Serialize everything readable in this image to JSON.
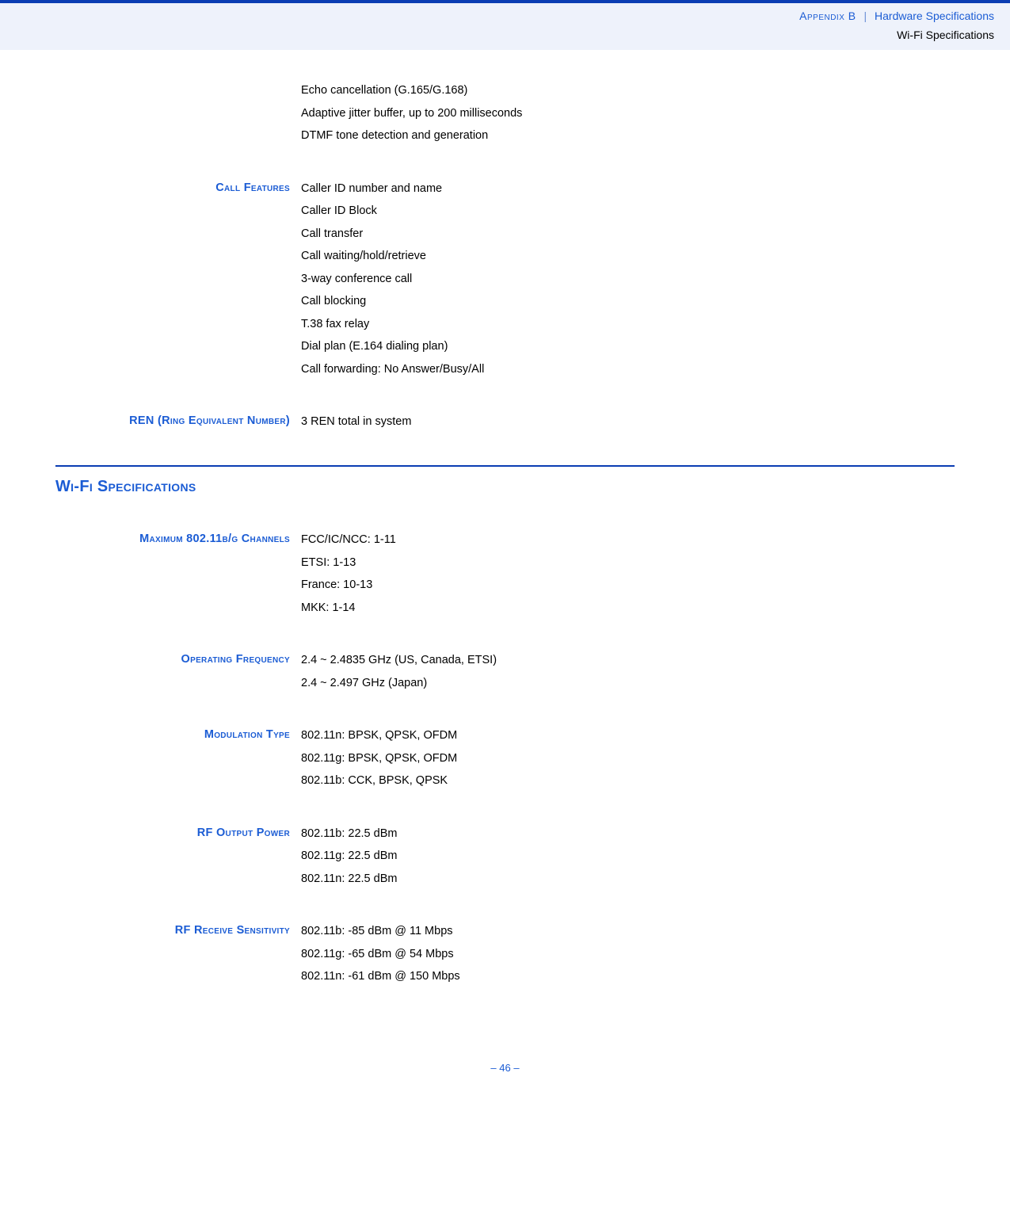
{
  "header": {
    "appendix_label": "Appendix B",
    "separator": "|",
    "chapter": "Hardware Specifications",
    "subtitle": "Wi-Fi Specifications"
  },
  "intro": {
    "lines": [
      "Echo cancellation (G.165/G.168)",
      "Adaptive jitter buffer, up to 200 milliseconds",
      "DTMF tone detection and generation"
    ]
  },
  "sections": [
    {
      "label": "Call Features",
      "lines": [
        "Caller ID number and name",
        "Caller ID Block",
        "Call transfer",
        "Call waiting/hold/retrieve",
        "3-way conference call",
        "Call blocking",
        "T.38 fax relay",
        "Dial plan (E.164 dialing plan)",
        "Call forwarding: No Answer/Busy/All"
      ]
    },
    {
      "label": "REN (Ring Equivalent Number)",
      "lines": [
        "3 REN total in system"
      ]
    }
  ],
  "wifi_title": "Wi-Fi Specifications",
  "wifi_sections": [
    {
      "label": "Maximum 802.11b/g Channels",
      "lines": [
        "FCC/IC/NCC: 1-11",
        "ETSI: 1-13",
        "France: 10-13",
        "MKK: 1-14"
      ]
    },
    {
      "label": "Operating Frequency",
      "lines": [
        "2.4 ~ 2.4835 GHz (US, Canada, ETSI)",
        "2.4 ~ 2.497 GHz (Japan)"
      ]
    },
    {
      "label": "Modulation Type",
      "lines": [
        "802.11n: BPSK, QPSK, OFDM",
        "802.11g: BPSK, QPSK, OFDM",
        "802.11b: CCK, BPSK, QPSK"
      ]
    },
    {
      "label": "RF Output Power",
      "lines": [
        "802.11b: 22.5 dBm",
        "802.11g: 22.5 dBm",
        "802.11n: 22.5 dBm"
      ]
    },
    {
      "label": "RF Receive Sensitivity",
      "lines": [
        "802.11b: -85 dBm @ 11 Mbps",
        "802.11g: -65 dBm @ 54 Mbps",
        "802.11n: -61 dBm @ 150 Mbps"
      ]
    }
  ],
  "footer": {
    "page": "–  46  –"
  }
}
